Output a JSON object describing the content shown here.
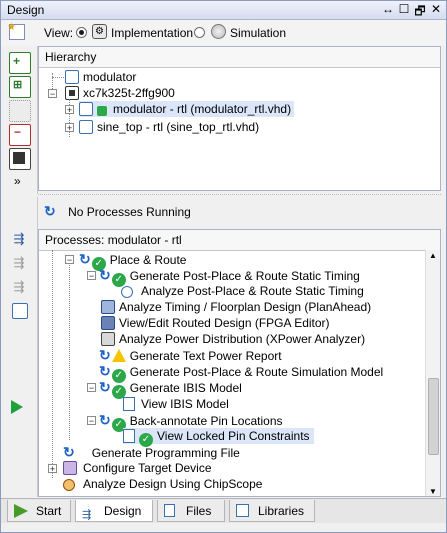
{
  "window": {
    "title": "Design",
    "controls": [
      "↔",
      "☐",
      "🗗",
      "✕"
    ]
  },
  "view_bar": {
    "label": "View:",
    "options": [
      {
        "label": "Implementation",
        "selected": true
      },
      {
        "label": "Simulation",
        "selected": false
      }
    ]
  },
  "hierarchy": {
    "header": "Hierarchy",
    "items": [
      {
        "label": "modulator",
        "level": 0
      },
      {
        "label": "xc7k325t-2ffg900",
        "level": 0
      },
      {
        "label": "modulator - rtl (modulator_rtl.vhd)",
        "level": 1,
        "selected": true
      },
      {
        "label": "sine_top - rtl (sine_top_rtl.vhd)",
        "level": 1
      }
    ]
  },
  "status": {
    "text": "No Processes Running"
  },
  "processes": {
    "header": "Processes: modulator - rtl",
    "items": [
      {
        "label": "Place & Route",
        "status": "ok"
      },
      {
        "label": "Generate Post-Place & Route Static Timing",
        "status": "ok"
      },
      {
        "label": "Analyze Post-Place & Route Static Timing",
        "status": "none"
      },
      {
        "label": "Analyze Timing / Floorplan Design (PlanAhead)",
        "status": "none"
      },
      {
        "label": "View/Edit Routed Design (FPGA Editor)",
        "status": "none"
      },
      {
        "label": "Analyze Power Distribution (XPower Analyzer)",
        "status": "none"
      },
      {
        "label": "Generate Text Power Report",
        "status": "warning"
      },
      {
        "label": "Generate Post-Place & Route Simulation Model",
        "status": "ok"
      },
      {
        "label": "Generate IBIS Model",
        "status": "ok"
      },
      {
        "label": "View IBIS Model",
        "status": "none"
      },
      {
        "label": "Back-annotate Pin Locations",
        "status": "ok"
      },
      {
        "label": "View Locked Pin Constraints",
        "status": "ok"
      },
      {
        "label": "Generate Programming File",
        "status": "none"
      },
      {
        "label": "Configure Target Device",
        "status": "none"
      },
      {
        "label": "Analyze Design Using ChipScope",
        "status": "none"
      }
    ]
  },
  "tabs": [
    {
      "label": "Start",
      "active": false
    },
    {
      "label": "Design",
      "active": true
    },
    {
      "label": "Files",
      "active": false
    },
    {
      "label": "Libraries",
      "active": false
    }
  ],
  "colors": {
    "ok": "#2ca84a",
    "warning": "#f5c400",
    "refresh": "#1f62c6",
    "selection": "#dbe6f8"
  }
}
